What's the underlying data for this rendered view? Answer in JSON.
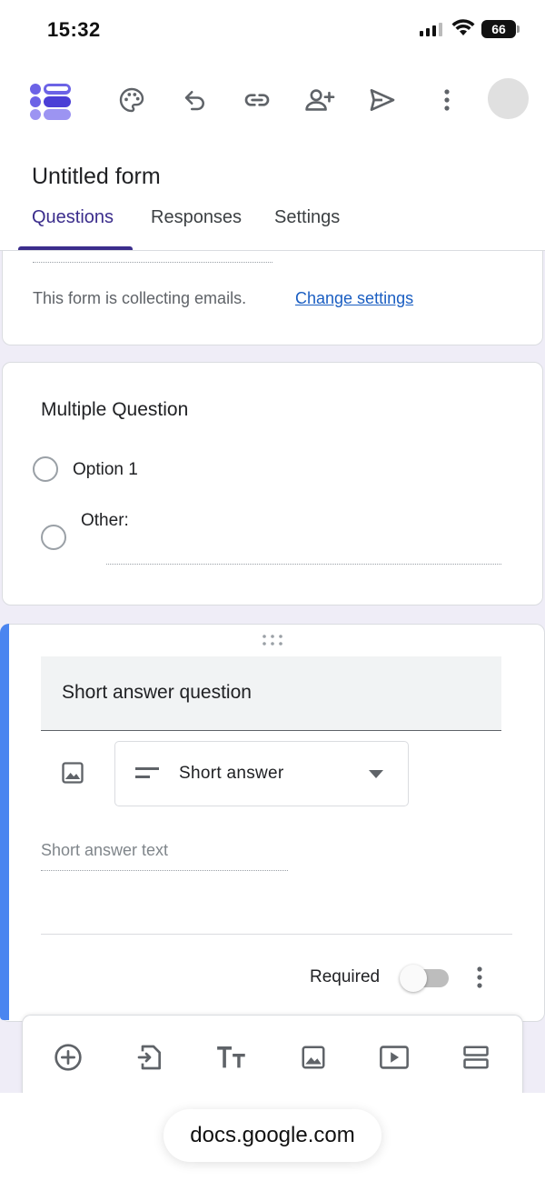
{
  "status_bar": {
    "time": "15:32",
    "battery": "66"
  },
  "toolbar": {
    "icons": [
      "forms-logo",
      "palette-icon",
      "undo-icon",
      "link-icon",
      "add-person-icon",
      "send-icon",
      "more-vert-icon",
      "avatar"
    ]
  },
  "form": {
    "title": "Untitled form"
  },
  "tabs": [
    {
      "label": "Questions",
      "active": true
    },
    {
      "label": "Responses",
      "active": false
    },
    {
      "label": "Settings",
      "active": false
    }
  ],
  "email_card": {
    "note": "This form is collecting emails.",
    "link": "Change settings"
  },
  "multiple_choice": {
    "title": "Multiple Question",
    "options": [
      "Option 1"
    ],
    "other_label": "Other:"
  },
  "short_answer": {
    "question": "Short answer question",
    "type_label": "Short answer",
    "placeholder": "Short answer text",
    "required_label": "Required",
    "required_on": false
  },
  "bottom_toolbar": {
    "icons": [
      "add-circle-icon",
      "import-icon",
      "title-text-icon",
      "image-icon",
      "video-icon",
      "section-icon"
    ]
  },
  "browser": {
    "url": "docs.google.com"
  },
  "colors": {
    "accent_purple": "#3b2d8c",
    "accent_blue": "#4a85f0",
    "link_blue": "#1a5ec2",
    "canvas_bg": "#efedf7"
  }
}
